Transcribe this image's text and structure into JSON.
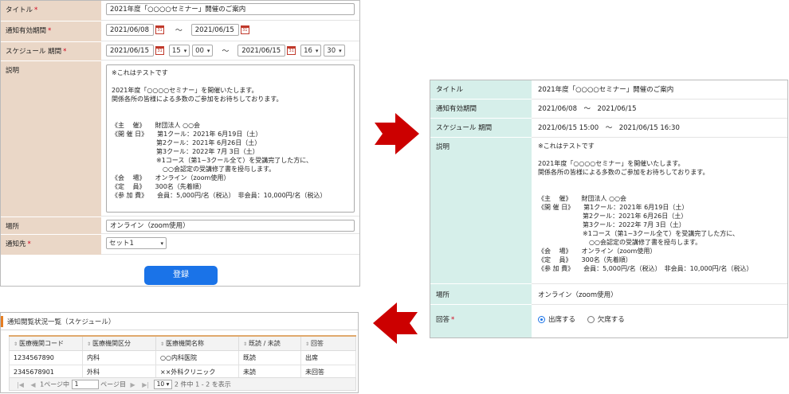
{
  "form": {
    "rows": {
      "title": {
        "label": "タイトル",
        "value": "2021年度「○○○○セミナー」開催のご案内"
      },
      "period": {
        "label": "通知有効期間",
        "start": "2021/06/08",
        "end": "2021/06/15",
        "tilde": "～"
      },
      "schedule": {
        "label": "スケジュール 期間",
        "start_date": "2021/06/15",
        "start_hour": "15",
        "start_min": "00",
        "end_date": "2021/06/15",
        "end_hour": "16",
        "end_min": "30",
        "tilde": "～"
      },
      "description": {
        "label": "説明"
      },
      "place": {
        "label": "場所",
        "value": "オンライン（zoom使用）"
      },
      "recipient": {
        "label": "通知先",
        "value": "セット1"
      }
    },
    "required_mark": "*",
    "submit_label": "登録"
  },
  "description_lines": [
    "※これはテストです",
    "",
    "2021年度「○○○○セミナー」を開催いたします。",
    "関係各所の皆様による多数のご参加をお待ちしております。",
    "",
    "",
    "《主　 催》　　財団法人 ○○会",
    "《開 催 日》　　第1クール：2021年 6月19日（土）",
    "　　　　　　　第2クール：2021年 6月26日（土）",
    "　　　　　　　第3クール：2022年 7月 3日（土）",
    "　　　　　　　※1コース（第1~3クール全て）を受講完了した方に、",
    "　　　　　　　　○○会認定の受講修了書を授与します。",
    "《会　 場》　　オンライン（zoom使用）",
    "《定　 員》　　300名（先着順）",
    "《参 加 費》　　会員：5,000円/名（税込）　非会員：10,000円/名（税込）"
  ],
  "detail": {
    "title": {
      "label": "タイトル",
      "value": "2021年度「○○○○セミナー」開催のご案内"
    },
    "period": {
      "label": "通知有効期間",
      "value": "2021/06/08　～　2021/06/15"
    },
    "schedule": {
      "label": "スケジュール 期間",
      "value": "2021/06/15  15:00　～　2021/06/15  16:30"
    },
    "description": {
      "label": "説明"
    },
    "place": {
      "label": "場所",
      "value": "オンライン（zoom使用）"
    },
    "answer": {
      "label": "回答",
      "required_mark": "*",
      "option_attend": "出席する",
      "option_absent": "欠席する"
    }
  },
  "status_list": {
    "title": "通知閲覧状況一覧（スケジュール）",
    "columns": [
      "医療機関コード",
      "医療機関区分",
      "医療機関名称",
      "既読 / 未読",
      "回答"
    ],
    "rows": [
      [
        "1234567890",
        "内科",
        "○○内科医院",
        "既読",
        "出席"
      ],
      [
        "2345678901",
        "外科",
        "××外科クリニック",
        "未読",
        "未回答"
      ]
    ],
    "pager": {
      "page_prefix": "1ページ中",
      "page_value": "1",
      "page_suffix": "ページ目",
      "per_page": "10",
      "summary": "2 件中 1 - 2 を表示"
    }
  },
  "colors": {
    "form_label_bg": "#ead7c7",
    "detail_label_bg": "#d6efea",
    "primary_button": "#1a73e8",
    "arrow_red": "#cc0000",
    "required": "#d0021b"
  },
  "icons": {
    "calendar": "calendar-icon",
    "chevron": "chevron-down-icon",
    "arrow_right": "arrow-right-icon",
    "arrow_left": "arrow-left-icon"
  }
}
